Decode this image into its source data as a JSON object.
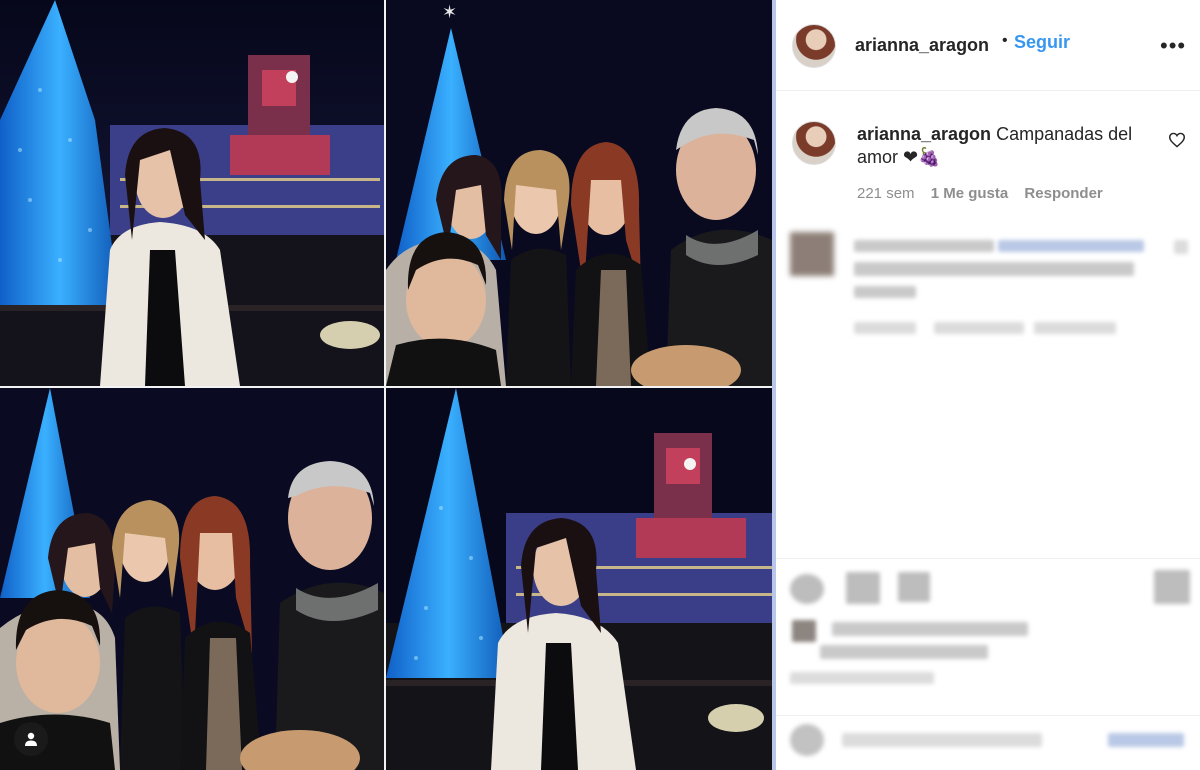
{
  "header": {
    "username": "arianna_aragon",
    "separator": "•",
    "follow_label": "Seguir",
    "more_icon": "more-horizontal-icon"
  },
  "caption": {
    "username": "arianna_aragon",
    "text": "Campanadas del amor ❤🍇",
    "age": "221 sem",
    "likes": "1 Me gusta",
    "reply_label": "Responder",
    "like_icon": "heart-outline-icon"
  },
  "photo": {
    "tag_icon": "user-tag-icon",
    "accent_tree": "#1e8cf0",
    "accent_building": "#d8485e"
  },
  "colors": {
    "link": "#3897f0",
    "secondary_text": "#8e8e8e",
    "primary_text": "#262626"
  }
}
